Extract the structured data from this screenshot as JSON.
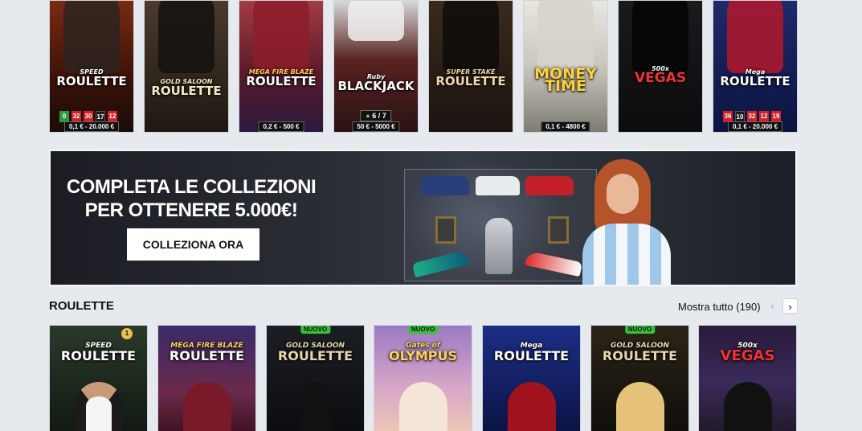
{
  "top_tiles": [
    {
      "logo_small": "SPEED",
      "logo": "ROULETTE",
      "numbers": [
        {
          "v": "0",
          "c": "green"
        },
        {
          "v": "32",
          "c": "red"
        },
        {
          "v": "30",
          "c": "red"
        },
        {
          "v": "17",
          "c": "black"
        },
        {
          "v": "12",
          "c": "red"
        }
      ],
      "stake": "0,1 € - 20.000 €"
    },
    {
      "logo_small": "GOLD SALOON",
      "logo": "ROULETTE",
      "stake": ""
    },
    {
      "logo_small": "MEGA FIRE BLAZE",
      "logo": "ROULETTE",
      "stake": "0,2 € - 500 €"
    },
    {
      "logo_small": "Ruby",
      "logo": "BLACKJACK",
      "seats": "6 / 7",
      "stake": "50 € - 5000 €"
    },
    {
      "logo_small": "SUPER STAKE",
      "logo": "ROULETTE",
      "stake": ""
    },
    {
      "logo_small": "",
      "logo": "MONEY TIME",
      "stake": "0,1 € - 4800 €"
    },
    {
      "logo_small": "500x",
      "logo": "VEGAS",
      "stake": ""
    },
    {
      "logo_small": "Mega",
      "logo": "ROULETTE",
      "numbers": [
        {
          "v": "36",
          "c": "red"
        },
        {
          "v": "10",
          "c": "black"
        },
        {
          "v": "32",
          "c": "red"
        },
        {
          "v": "12",
          "c": "red"
        },
        {
          "v": "19",
          "c": "red"
        }
      ],
      "stake": "0,1 € - 20.000 €"
    }
  ],
  "banner": {
    "headline_line1": "COMPLETA LE COLLEZIONI",
    "headline_line2": "PER OTTENERE 5.000€!",
    "cta": "COLLEZIONA ORA"
  },
  "section": {
    "title": "ROULETTE",
    "show_all": "Mostra tutto (190)",
    "prev_icon": "chevron-left-icon",
    "next_icon": "chevron-right-icon"
  },
  "bottom_tiles": [
    {
      "logo_small": "SPEED",
      "logo": "ROULETTE",
      "badge": "1",
      "new": ""
    },
    {
      "logo_small": "MEGA FIRE BLAZE",
      "logo": "ROULETTE",
      "new": ""
    },
    {
      "logo_small": "GOLD SALOON",
      "logo": "ROULETTE",
      "new": "NUOVO"
    },
    {
      "logo_small": "Gates of",
      "logo": "OLYMPUS",
      "new": "NUOVO"
    },
    {
      "logo_small": "Mega",
      "logo": "ROULETTE",
      "new": ""
    },
    {
      "logo_small": "GOLD SALOON",
      "logo": "ROULETTE",
      "new": "NUOVO"
    },
    {
      "logo_small": "500x",
      "logo": "VEGAS",
      "new": ""
    }
  ]
}
